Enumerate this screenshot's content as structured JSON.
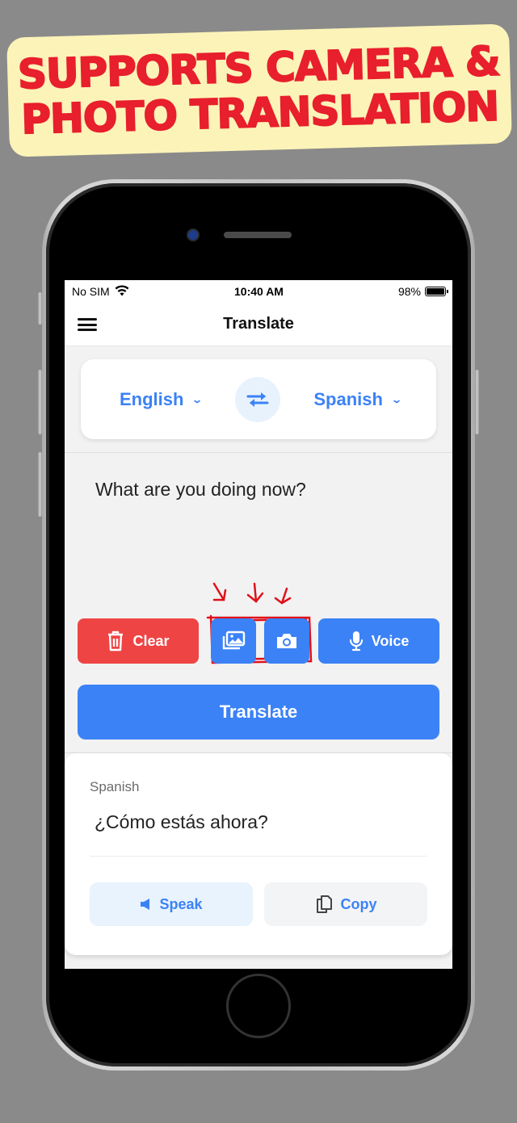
{
  "banner": {
    "line1": "Supports Camera &",
    "line2": "Photo Translation"
  },
  "statusbar": {
    "carrier": "No SIM",
    "time": "10:40 AM",
    "battery_percent": "98%",
    "battery_level": 0.98
  },
  "navbar": {
    "title": "Translate",
    "menu_icon": "hamburger-menu-icon"
  },
  "languages": {
    "source": "English",
    "target": "Spanish",
    "swap_icon": "swap-arrows-icon"
  },
  "input": {
    "value": "What are you doing now?"
  },
  "actions": {
    "clear_label": "Clear",
    "photo_icon": "photo-gallery-icon",
    "camera_icon": "camera-icon",
    "voice_label": "Voice"
  },
  "translate_button": {
    "label": "Translate"
  },
  "result": {
    "language": "Spanish",
    "text": "¿Cómo estás ahora?",
    "speak_label": "Speak",
    "copy_label": "Copy"
  },
  "colors": {
    "primary": "#3b82f6",
    "danger": "#ef4444",
    "banner_bg": "#fcf3b8",
    "banner_text": "#e81f2c",
    "annotation": "#e0101a"
  }
}
